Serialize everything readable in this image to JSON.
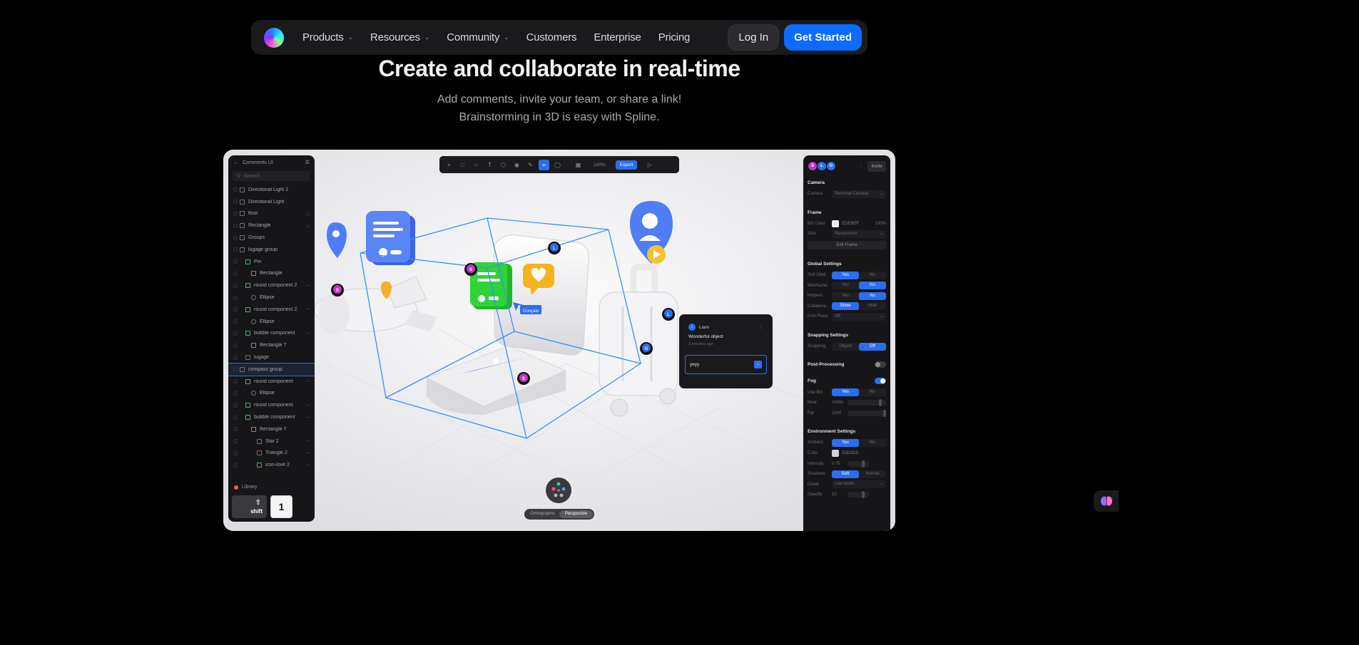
{
  "nav": {
    "items": [
      {
        "label": "Products",
        "has_menu": true
      },
      {
        "label": "Resources",
        "has_menu": true
      },
      {
        "label": "Community",
        "has_menu": true
      },
      {
        "label": "Customers",
        "has_menu": false
      },
      {
        "label": "Enterprise",
        "has_menu": false
      },
      {
        "label": "Pricing",
        "has_menu": false
      }
    ],
    "login": "Log In",
    "get_started": "Get Started"
  },
  "hero": {
    "title": "Create and collaborate in real-time",
    "sub1": "Add comments, invite your team, or share a link!",
    "sub2": "Brainstorming in 3D is easy with Spline."
  },
  "editor": {
    "file_name": "Comments UI",
    "search_placeholder": "Search",
    "layers": [
      {
        "label": "Directional Light 2",
        "indent": 0,
        "icon": "light-icon"
      },
      {
        "label": "Directional Light",
        "indent": 0,
        "icon": "light-icon"
      },
      {
        "label": "floor",
        "indent": 0,
        "icon": "group-icon",
        "trail": "lock"
      },
      {
        "label": "Rectangle",
        "indent": 0,
        "icon": "rectangle-icon",
        "trail": "lock"
      },
      {
        "label": "Groups",
        "indent": 0,
        "icon": "group-icon"
      },
      {
        "label": "lugage group",
        "indent": 0,
        "icon": "group-icon"
      },
      {
        "label": "Pin",
        "indent": 1,
        "icon": "component-icon"
      },
      {
        "label": "Rectangle",
        "indent": 2,
        "icon": "path-icon"
      },
      {
        "label": "round component 2",
        "indent": 1,
        "icon": "component-icon",
        "trail": "dots"
      },
      {
        "label": "Ellipse",
        "indent": 2,
        "icon": "ellipse-icon"
      },
      {
        "label": "round component 2",
        "indent": 1,
        "icon": "component-icon",
        "trail": "dots"
      },
      {
        "label": "Ellipse",
        "indent": 2,
        "icon": "ellipse-icon"
      },
      {
        "label": "bubble component",
        "indent": 1,
        "icon": "component-icon",
        "trail": "dots"
      },
      {
        "label": "Rectangle 7",
        "indent": 2,
        "icon": "path-icon"
      },
      {
        "label": "lugage",
        "indent": 1,
        "icon": "group-icon"
      },
      {
        "label": "compass group",
        "indent": 0,
        "icon": "group-icon",
        "selected": true
      },
      {
        "label": "round component",
        "indent": 1,
        "icon": "component-icon",
        "trail": "dots"
      },
      {
        "label": "Ellipse",
        "indent": 2,
        "icon": "ellipse-icon"
      },
      {
        "label": "round component",
        "indent": 1,
        "icon": "component-icon",
        "trail": "dots"
      },
      {
        "label": "bubble component",
        "indent": 1,
        "icon": "component-icon",
        "trail": "dots"
      },
      {
        "label": "Rectangle 7",
        "indent": 2,
        "icon": "path-icon"
      },
      {
        "label": "Star 2",
        "indent": 3,
        "icon": "star-icon",
        "trail": "dots"
      },
      {
        "label": "Triangle 2",
        "indent": 3,
        "icon": "triangle-icon",
        "trail": "dots"
      },
      {
        "label": "icon-love 2",
        "indent": 3,
        "icon": "path-icon",
        "trail": "dots"
      }
    ],
    "library": "Library",
    "keys": {
      "shift": "shift",
      "one": "1"
    },
    "toolbar": {
      "zoom": "100%",
      "export": "Export"
    },
    "view_switch": {
      "ortho": "Orthographic",
      "persp": "Perspective"
    },
    "name_tag": "Gonçalo",
    "comment": {
      "author_initial": "L",
      "author": "Liam",
      "text": "Wonderful object",
      "time": "3 minutes ago",
      "reply": "yeyy"
    },
    "avatars": [
      {
        "initial": "S",
        "color": "#c434c7"
      },
      {
        "initial": "L",
        "color": "#2b6ef0"
      },
      {
        "initial": "G",
        "color": "#2b6ef0"
      }
    ],
    "scene_markers": [
      {
        "initial": "S",
        "color": "#c434c7"
      },
      {
        "initial": "S",
        "color": "#c434c7"
      },
      {
        "initial": "L",
        "color": "#2b6ef0"
      },
      {
        "initial": "L",
        "color": "#2b6ef0"
      },
      {
        "initial": "G",
        "color": "#2b6ef0"
      },
      {
        "initial": "S",
        "color": "#c434c7"
      }
    ],
    "props": {
      "invite": "Invite",
      "camera": "Camera",
      "camera_k": "Camera",
      "camera_v": "Personal Camera",
      "frame": "Frame",
      "bg_k": "BG Color",
      "bg_v": "EDEBEF",
      "bg_pct": "100%",
      "size_k": "Size",
      "size_v": "Responsive",
      "edit_frame": "Edit Frame",
      "global": "Global Settings",
      "soft_orbit": "Soft Orbit",
      "wireframe": "Wireframe",
      "helpers": "Helpers",
      "collab": "Collabora..",
      "grid": "Grid Plane",
      "grid_v": "Off",
      "yes": "Yes",
      "no": "No",
      "show": "Show",
      "hide": "Hide",
      "snapping": "Snapping Settings",
      "snapping_k": "Snapping",
      "object": "Object",
      "off": "Off",
      "post": "Post-Processing",
      "fog": "Fog",
      "use_bg": "Use BG",
      "near_k": "Near",
      "near_v": "1608x",
      "far_k": "Far",
      "far_v": "2000",
      "env": "Environment Settings",
      "ambient": "Ambient",
      "color_k": "Color",
      "color_v": "D3D3D3",
      "intensity_k": "Intensity",
      "intensity_v": "0.75",
      "shadows": "Shadows",
      "soft": "Soft",
      "normal": "Normal",
      "detail_k": "Detail",
      "detail_v": "Low faster",
      "opacity_k": "Opacity",
      "opacity_v": "10"
    }
  },
  "colors": {
    "accent": "#0d6bff",
    "panel": "#161618",
    "selection": "#3d8ef5"
  }
}
